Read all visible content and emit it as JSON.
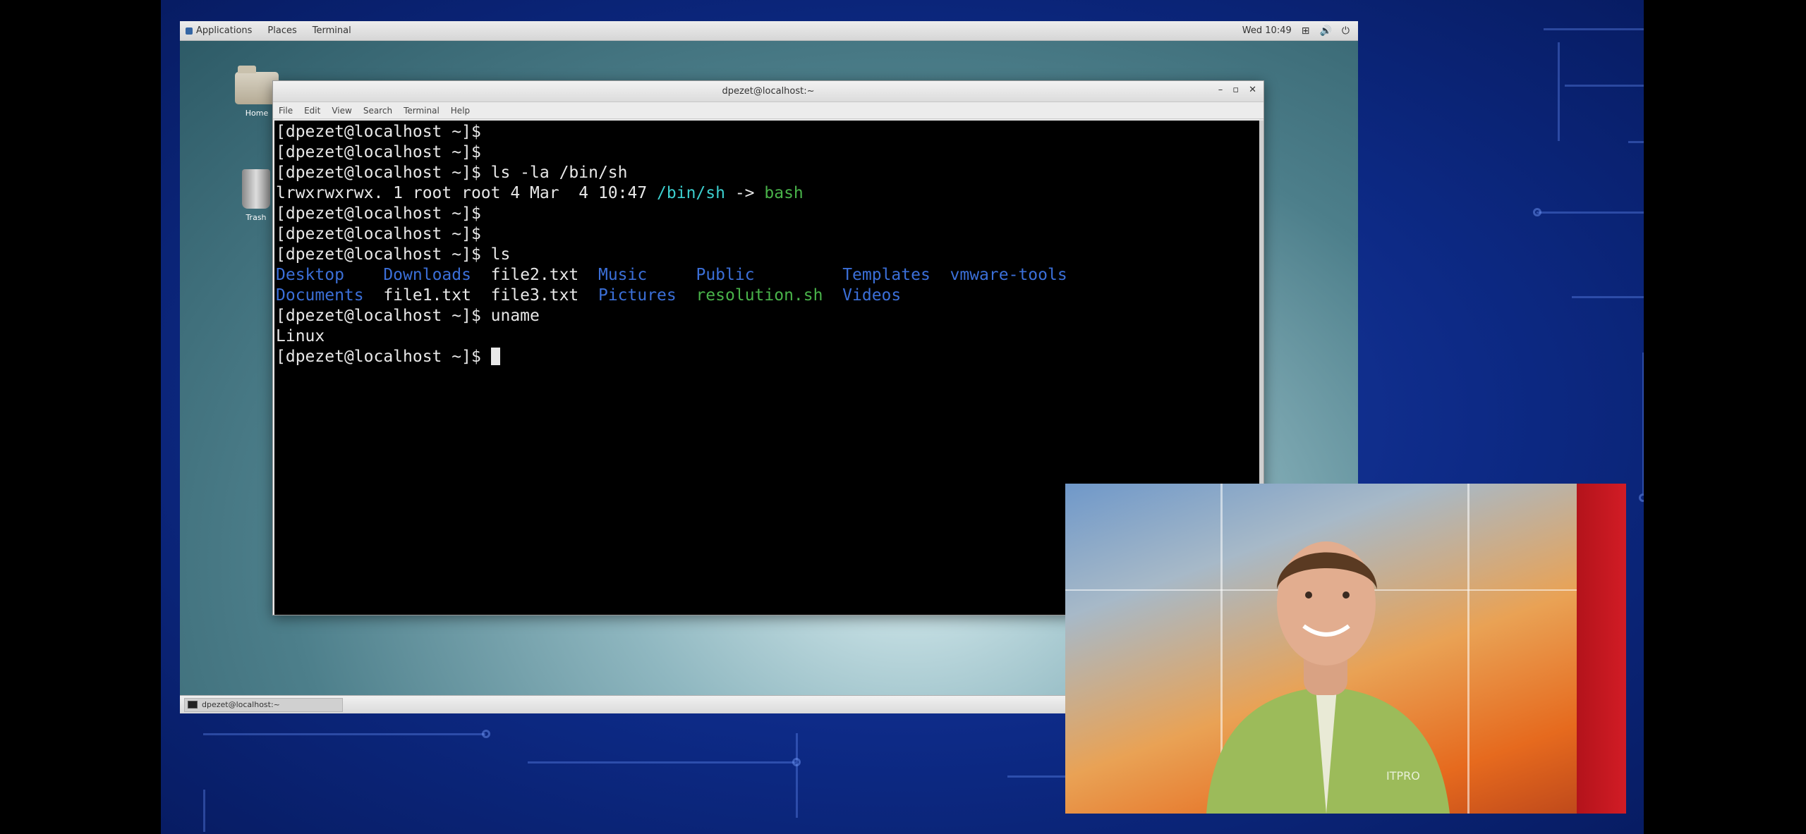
{
  "desktop": {
    "topbar": {
      "menus": [
        "Applications",
        "Places",
        "Terminal"
      ],
      "clock": "Wed 10:49"
    },
    "icons": [
      {
        "label": "Home",
        "icon": "home-folder-icon"
      },
      {
        "label": "Trash",
        "icon": "trash-icon"
      }
    ]
  },
  "window": {
    "title": "dpezet@localhost:~",
    "menubar": [
      "File",
      "Edit",
      "View",
      "Search",
      "Terminal",
      "Help"
    ]
  },
  "terminal": {
    "lines": [
      [
        {
          "t": "[dpezet@localhost ~]$ ",
          "c": ""
        }
      ],
      [
        {
          "t": "[dpezet@localhost ~]$ ",
          "c": ""
        }
      ],
      [
        {
          "t": "[dpezet@localhost ~]$ ls -la /bin/sh",
          "c": ""
        }
      ],
      [
        {
          "t": "lrwxrwxrwx. 1 root root 4 Mar  4 10:47 ",
          "c": ""
        },
        {
          "t": "/bin/sh",
          "c": "cyan"
        },
        {
          "t": " -> ",
          "c": ""
        },
        {
          "t": "bash",
          "c": "green"
        }
      ],
      [
        {
          "t": "[dpezet@localhost ~]$ ",
          "c": ""
        }
      ],
      [
        {
          "t": "[dpezet@localhost ~]$ ",
          "c": ""
        }
      ],
      [
        {
          "t": "[dpezet@localhost ~]$ ls",
          "c": ""
        }
      ],
      [
        {
          "t": "Desktop",
          "c": "blue"
        },
        {
          "t": "    ",
          "c": ""
        },
        {
          "t": "Downloads",
          "c": "blue"
        },
        {
          "t": "  file2.txt  ",
          "c": ""
        },
        {
          "t": "Music",
          "c": "blue"
        },
        {
          "t": "     ",
          "c": ""
        },
        {
          "t": "Public",
          "c": "blue"
        },
        {
          "t": "         ",
          "c": ""
        },
        {
          "t": "Templates",
          "c": "blue"
        },
        {
          "t": "  ",
          "c": ""
        },
        {
          "t": "vmware-tools",
          "c": "blue"
        }
      ],
      [
        {
          "t": "Documents",
          "c": "blue"
        },
        {
          "t": "  file1.txt  file3.txt  ",
          "c": ""
        },
        {
          "t": "Pictures",
          "c": "blue"
        },
        {
          "t": "  ",
          "c": ""
        },
        {
          "t": "resolution.sh",
          "c": "green"
        },
        {
          "t": "  ",
          "c": ""
        },
        {
          "t": "Videos",
          "c": "blue"
        }
      ],
      [
        {
          "t": "[dpezet@localhost ~]$ uname",
          "c": ""
        }
      ],
      [
        {
          "t": "Linux",
          "c": ""
        }
      ],
      [
        {
          "t": "[dpezet@localhost ~]$ ",
          "c": ""
        }
      ]
    ]
  },
  "taskbar": {
    "item": "dpezet@localhost:~"
  },
  "presenter": {
    "shirt_logo": "ITPRO"
  },
  "colors": {
    "terminal_bg": "#000000",
    "dir_blue": "#3b6fd8",
    "exec_green": "#49b34a",
    "link_cyan": "#3ccfcf",
    "backdrop_blue": "#0d2a86"
  }
}
